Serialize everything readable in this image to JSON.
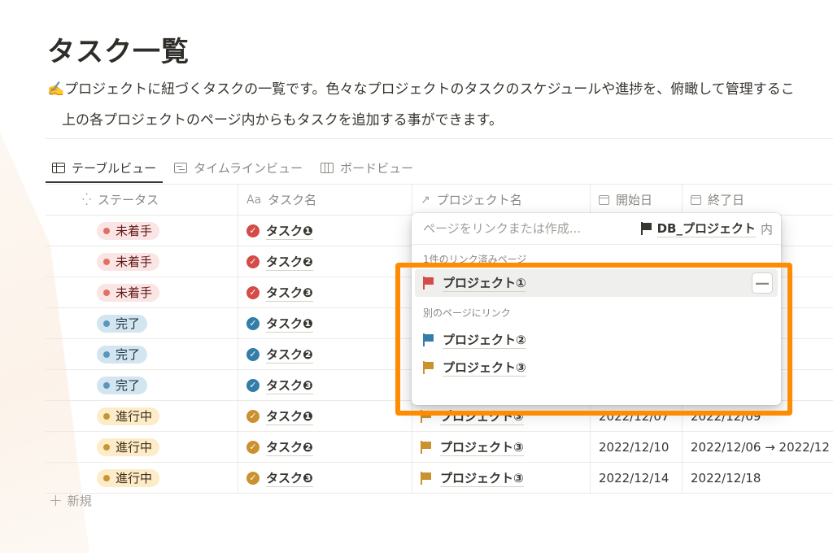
{
  "page": {
    "title": "タスク一覧",
    "description_line1": "✍️プロジェクトに紐づくタスクの一覧です。色々なプロジェクトのタスクのスケジュールや進捗を、俯瞰して管理するこ",
    "description_line2": "上の各プロジェクトのページ内からもタスクを追加する事ができます。"
  },
  "views": [
    {
      "label": "テーブルビュー",
      "icon": "table-icon",
      "active": true
    },
    {
      "label": "タイムラインビュー",
      "icon": "timeline-icon",
      "active": false
    },
    {
      "label": "ボードビュー",
      "icon": "board-icon",
      "active": false
    }
  ],
  "columns": {
    "status": {
      "label": "ステータス",
      "icon": "status-icon"
    },
    "task": {
      "label": "タスク名",
      "icon_text": "Aa"
    },
    "project": {
      "label": "プロジェクト名",
      "icon_text": "↗"
    },
    "start": {
      "label": "開始日",
      "icon": "calendar-icon"
    },
    "end": {
      "label": "終了日",
      "icon": "calendar-icon"
    }
  },
  "rows": [
    {
      "status": "未着手",
      "status_color": "red",
      "task": "タスク❶",
      "project": "",
      "start": "",
      "end": ""
    },
    {
      "status": "未着手",
      "status_color": "red",
      "task": "タスク❷",
      "project": "",
      "start": "",
      "end": ""
    },
    {
      "status": "未着手",
      "status_color": "red",
      "task": "タスク❸",
      "project": "",
      "start": "",
      "end": ""
    },
    {
      "status": "完了",
      "status_color": "blue",
      "task": "タスク❶",
      "project": "",
      "start": "",
      "end": ""
    },
    {
      "status": "完了",
      "status_color": "blue",
      "task": "タスク❷",
      "project": "",
      "start": "",
      "end": ""
    },
    {
      "status": "完了",
      "status_color": "blue",
      "task": "タスク❸",
      "project": "",
      "start": "",
      "end": ""
    },
    {
      "status": "進行中",
      "status_color": "yellow",
      "task": "タスク❶",
      "project": "プロジェクト③",
      "start": "2022/12/07",
      "end": "2022/12/09"
    },
    {
      "status": "進行中",
      "status_color": "yellow",
      "task": "タスク❷",
      "project": "プロジェクト③",
      "start": "2022/12/10",
      "end": "2022/12/06 → 2022/12"
    },
    {
      "status": "進行中",
      "status_color": "yellow",
      "task": "タスク❸",
      "project": "プロジェクト③",
      "start": "2022/12/14",
      "end": "2022/12/18"
    }
  ],
  "new_row_label": "新規",
  "relation_popup": {
    "search_placeholder": "ページをリンクまたは作成...",
    "database_name": "DB_プロジェクト",
    "database_suffix": "内",
    "linked_section_label": "1件のリンク済みページ",
    "linked_pages": [
      {
        "name": "プロジェクト①",
        "flag_color": "#d44c47"
      }
    ],
    "other_section_label": "別のページにリンク",
    "other_pages": [
      {
        "name": "プロジェクト②",
        "flag_color": "#337ea9"
      },
      {
        "name": "プロジェクト③",
        "flag_color": "#cb912f"
      }
    ],
    "remove_label": "—"
  },
  "colors": {
    "highlight": "#ff8c00",
    "status_red_bg": "#fbe4e4",
    "status_blue_bg": "#d3e5ef",
    "status_yellow_bg": "#fdecc8"
  }
}
